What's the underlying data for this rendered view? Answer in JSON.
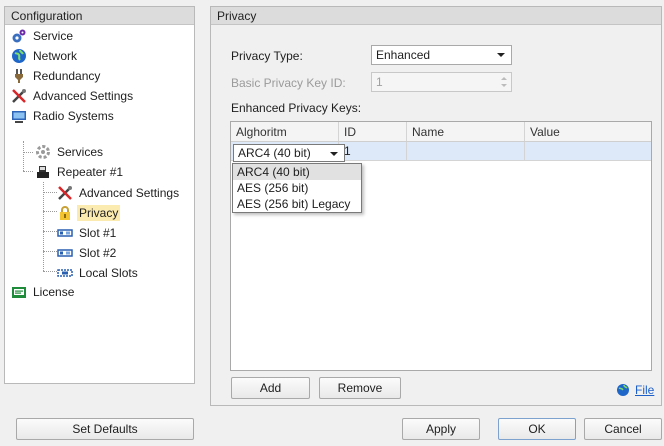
{
  "left_panel": {
    "title": "Configuration",
    "items": [
      {
        "label": "Service",
        "icon": "service-gear-icon"
      },
      {
        "label": "Network",
        "icon": "network-globe-icon"
      },
      {
        "label": "Redundancy",
        "icon": "redundancy-plug-icon"
      },
      {
        "label": "Advanced Settings",
        "icon": "tools-icon"
      },
      {
        "label": "Radio Systems",
        "icon": "radio-systems-icon"
      },
      {
        "label": "Services",
        "icon": "services-gear-icon"
      },
      {
        "label": "Repeater #1",
        "icon": "repeater-icon"
      },
      {
        "label": "Advanced Settings",
        "icon": "tools-icon"
      },
      {
        "label": "Privacy",
        "icon": "lock-icon"
      },
      {
        "label": "Slot #1",
        "icon": "slot-icon"
      },
      {
        "label": "Slot #2",
        "icon": "slot-icon"
      },
      {
        "label": "Local Slots",
        "icon": "local-slot-icon"
      },
      {
        "label": "License",
        "icon": "license-icon"
      }
    ],
    "selected": "Privacy"
  },
  "right_panel": {
    "title": "Privacy",
    "privacy_type_label": "Privacy Type:",
    "privacy_type_value": "Enhanced",
    "basic_key_label": "Basic Privacy Key ID:",
    "basic_key_value": "1",
    "enhanced_keys_label": "Enhanced Privacy Keys:",
    "grid": {
      "columns": [
        "Alghoritm",
        "ID",
        "Name",
        "Value"
      ],
      "rows": [
        {
          "algorithm": "ARC4 (40 bit)",
          "id": "1",
          "name": "",
          "value": ""
        }
      ]
    },
    "dropdown_options": [
      "ARC4 (40 bit)",
      "AES (256 bit)",
      "AES (256 bit) Legacy"
    ],
    "add_label": "Add",
    "remove_label": "Remove",
    "file_label": "File"
  },
  "footer": {
    "set_defaults_label": "Set Defaults",
    "apply_label": "Apply",
    "ok_label": "OK",
    "cancel_label": "Cancel"
  }
}
